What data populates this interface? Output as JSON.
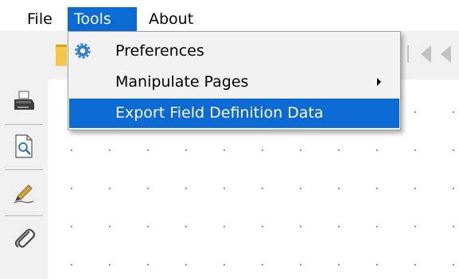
{
  "menubar": {
    "items": [
      {
        "label": "File"
      },
      {
        "label": "Tools",
        "active": true
      },
      {
        "label": "About"
      }
    ]
  },
  "tools_menu": {
    "items": [
      {
        "label": "Preferences",
        "icon": "gear-icon"
      },
      {
        "label": "Manipulate Pages",
        "has_submenu": true
      },
      {
        "label": "Export Field Definition Data",
        "highlighted": true
      }
    ]
  },
  "toolbar": {
    "icons": [
      "folder-icon",
      "nav-back-icon",
      "nav-back-icon"
    ]
  },
  "left_tools": {
    "icons": [
      "printer-icon",
      "print-preview-icon",
      "pen-icon",
      "paperclip-icon"
    ]
  },
  "colors": {
    "accent": "#0b6ad3",
    "toolbar_bg": "#f0f0f0",
    "menu_bg": "#f2f2f2"
  }
}
